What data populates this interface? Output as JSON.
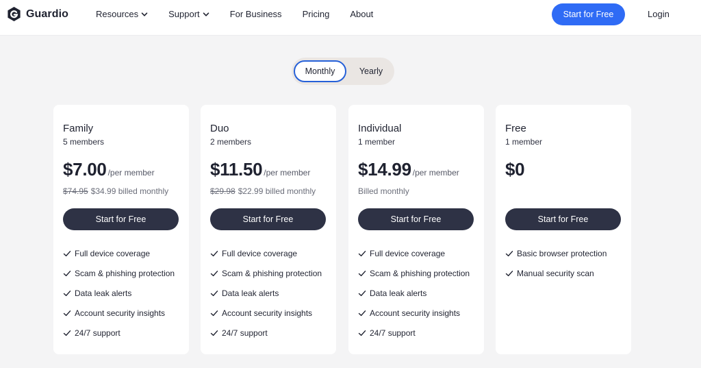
{
  "header": {
    "brand": "Guardio",
    "nav": [
      {
        "label": "Resources",
        "has_dropdown": true
      },
      {
        "label": "Support",
        "has_dropdown": true
      },
      {
        "label": "For Business",
        "has_dropdown": false
      },
      {
        "label": "Pricing",
        "has_dropdown": false
      },
      {
        "label": "About",
        "has_dropdown": false
      }
    ],
    "cta_label": "Start for Free",
    "login_label": "Login"
  },
  "toggle": {
    "options": [
      "Monthly",
      "Yearly"
    ],
    "selected": "Monthly"
  },
  "plans": [
    {
      "name": "Family",
      "members": "5 members",
      "price": "$7.00",
      "per": "/per member",
      "old_price": "$74.95",
      "billing": "$34.99 billed monthly",
      "cta": "Start for Free",
      "features": [
        "Full device coverage",
        "Scam & phishing protection",
        "Data leak alerts",
        "Account security insights",
        "24/7 support"
      ]
    },
    {
      "name": "Duo",
      "members": "2 members",
      "price": "$11.50",
      "per": "/per member",
      "old_price": "$29.98",
      "billing": "$22.99 billed monthly",
      "cta": "Start for Free",
      "features": [
        "Full device coverage",
        "Scam & phishing protection",
        "Data leak alerts",
        "Account security insights",
        "24/7 support"
      ]
    },
    {
      "name": "Individual",
      "members": "1 member",
      "price": "$14.99",
      "per": "/per member",
      "old_price": "",
      "billing": "Billed monthly",
      "cta": "Start for Free",
      "features": [
        "Full device coverage",
        "Scam & phishing protection",
        "Data leak alerts",
        "Account security insights",
        "24/7 support"
      ]
    },
    {
      "name": "Free",
      "members": "1 member",
      "price": "$0",
      "per": "",
      "old_price": "",
      "billing": "",
      "cta": "Start for Free",
      "features": [
        "Basic browser protection",
        "Manual security scan"
      ]
    }
  ],
  "colors": {
    "primary_blue": "#2f6bf5",
    "dark_button": "#2e3245",
    "page_bg": "#f4f4f5",
    "toggle_bg": "#eae6e3"
  },
  "icons": {
    "logo": "guardio-g-shield-icon",
    "dropdown": "chevron-down-icon",
    "feature": "check-icon"
  }
}
